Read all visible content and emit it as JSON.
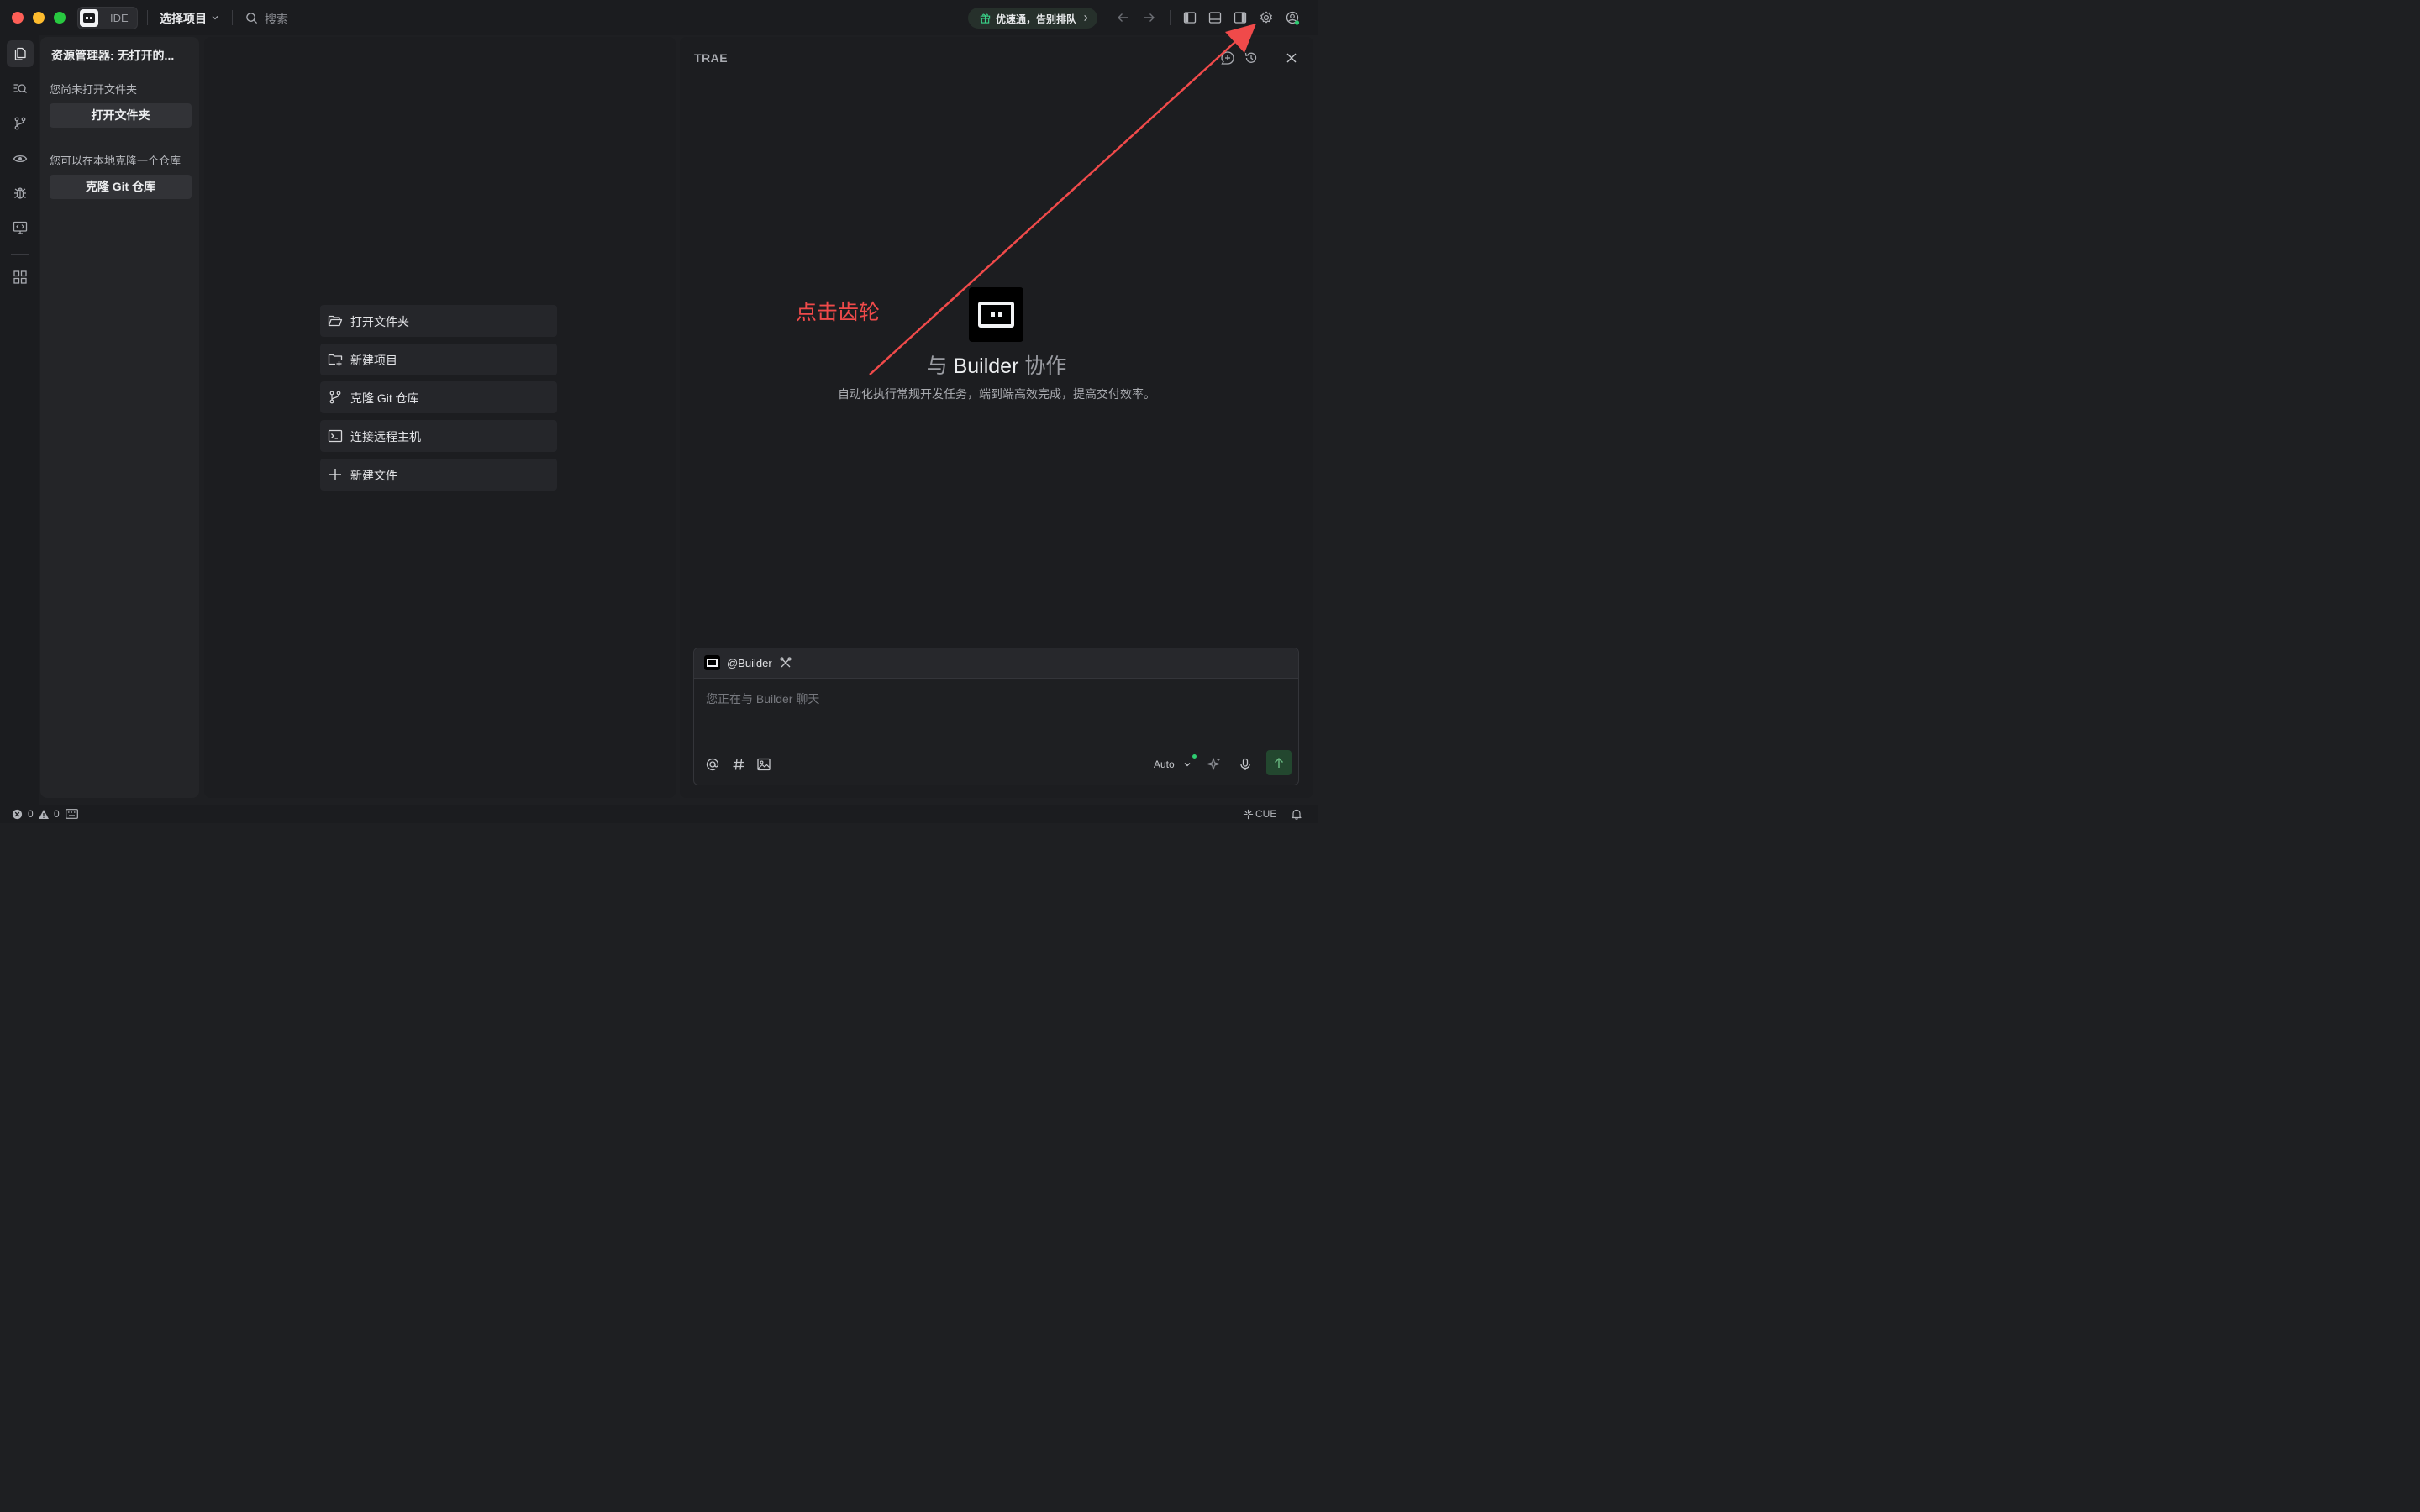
{
  "titlebar": {
    "app_chip": "IDE",
    "project_selector": "选择项目",
    "search_placeholder": "搜索",
    "promo": "优速通，告别排队"
  },
  "explorer": {
    "title": "资源管理器: 无打开的...",
    "no_folder_note": "您尚未打开文件夹",
    "open_folder": "打开文件夹",
    "clone_note": "您可以在本地克隆一个仓库",
    "clone_repo": "克隆 Git 仓库"
  },
  "quick_actions": [
    {
      "label": "打开文件夹",
      "icon": "folder-open-icon"
    },
    {
      "label": "新建项目",
      "icon": "new-project-icon"
    },
    {
      "label": "克隆 Git 仓库",
      "icon": "git-branch-icon"
    },
    {
      "label": "连接远程主机",
      "icon": "terminal-icon"
    },
    {
      "label": "新建文件",
      "icon": "plus-icon"
    }
  ],
  "chat": {
    "title": "TRAE",
    "hero_prefix": "与",
    "hero_agent": "Builder",
    "hero_suffix": "协作",
    "hero_desc": "自动化执行常规开发任务，端到端高效完成，提高交付效率。",
    "agent_mention": "@Builder",
    "input_placeholder": "您正在与 Builder 聊天",
    "mode": "Auto"
  },
  "annotation": {
    "text": "点击齿轮",
    "color": "#f04a4a"
  },
  "statusbar": {
    "errors": "0",
    "warnings": "0",
    "language": "CUE"
  },
  "colors": {
    "background": "#1e1f22",
    "panel": "#242528",
    "accent_green": "#2ecc71",
    "send_button": "#23472f"
  }
}
